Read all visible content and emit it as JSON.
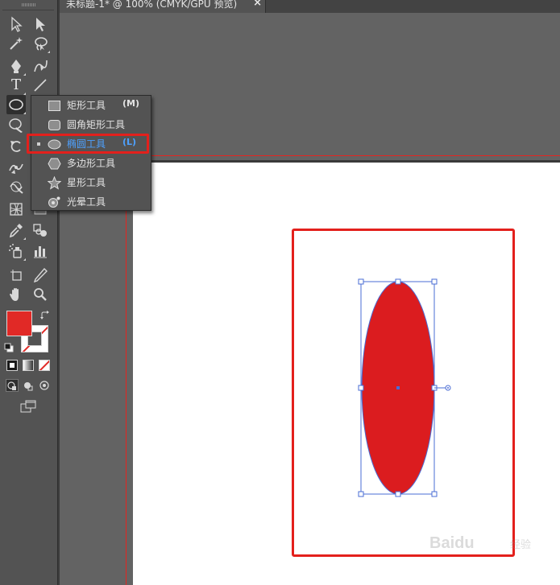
{
  "document": {
    "tab_title": "未标题-1* @ 100% (CMYK/GPU 预览)",
    "close_glyph": "×"
  },
  "toolbox": {
    "tools": [
      {
        "id": "selection",
        "icon": "selection-arrow-icon"
      },
      {
        "id": "direct-selection",
        "icon": "direct-selection-arrow-icon"
      },
      {
        "id": "magic-wand",
        "icon": "magic-wand-icon"
      },
      {
        "id": "lasso",
        "icon": "lasso-icon"
      },
      {
        "id": "pen",
        "icon": "pen-icon"
      },
      {
        "id": "curvature",
        "icon": "curvature-pen-icon"
      },
      {
        "id": "type",
        "icon": "type-icon",
        "glyph": "T"
      },
      {
        "id": "line",
        "icon": "line-segment-icon"
      },
      {
        "id": "ellipse",
        "icon": "ellipse-icon",
        "active": true
      },
      {
        "id": "brush",
        "icon": "paintbrush-icon"
      },
      {
        "id": "rotate",
        "icon": "rotate-icon"
      },
      {
        "id": "width",
        "icon": "width-icon"
      },
      {
        "id": "warp",
        "icon": "warp-icon"
      },
      {
        "id": "mesh",
        "icon": "mesh-icon"
      },
      {
        "id": "eyedropper",
        "icon": "eyedropper-icon"
      },
      {
        "id": "blend",
        "icon": "blend-icon"
      },
      {
        "id": "symbol-sprayer",
        "icon": "symbol-sprayer-icon"
      },
      {
        "id": "graph",
        "icon": "column-graph-icon"
      },
      {
        "id": "artboard",
        "icon": "artboard-icon"
      },
      {
        "id": "slice",
        "icon": "slice-icon"
      },
      {
        "id": "hand",
        "icon": "hand-icon"
      },
      {
        "id": "zoom",
        "icon": "zoom-icon"
      }
    ],
    "fill_color": "#e12926",
    "stroke_color": "none"
  },
  "flyout": {
    "items": [
      {
        "label": "矩形工具",
        "shortcut": "(M)",
        "icon": "rectangle-icon",
        "selected": false
      },
      {
        "label": "圆角矩形工具",
        "shortcut": "",
        "icon": "rounded-rectangle-icon",
        "selected": false
      },
      {
        "label": "椭圆工具",
        "shortcut": "(L)",
        "icon": "ellipse-icon",
        "selected": true
      },
      {
        "label": "多边形工具",
        "shortcut": "",
        "icon": "polygon-icon",
        "selected": false
      },
      {
        "label": "星形工具",
        "shortcut": "",
        "icon": "star-icon",
        "selected": false
      },
      {
        "label": "光晕工具",
        "shortcut": "",
        "icon": "flare-icon",
        "selected": false
      }
    ]
  },
  "canvas": {
    "shape_fill": "#db1c1f",
    "selection_color": "#4a6cd4",
    "annotation_color": "#e3201c"
  },
  "watermark": {
    "text": "Baidu",
    "sub": "经验"
  }
}
